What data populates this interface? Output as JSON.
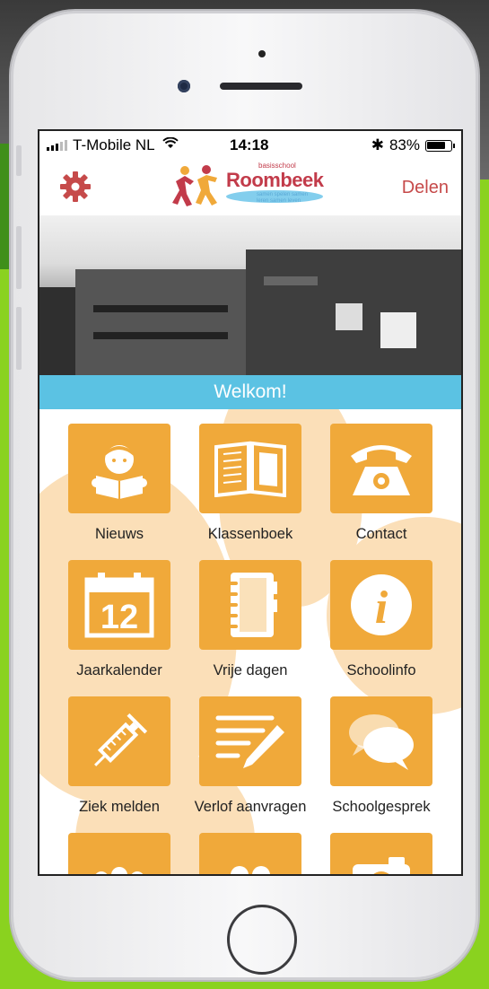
{
  "status_bar": {
    "carrier": "T-Mobile NL",
    "time": "14:18",
    "bluetooth": "✱",
    "battery": "83%",
    "battery_level": 0.83
  },
  "nav": {
    "logo_small": "basisschool",
    "logo_name": "Roombeek",
    "logo_tagline": "samen spelen samen leren samen leven",
    "share_label": "Delen"
  },
  "banner": {
    "welcome": "Welkom!"
  },
  "tiles": [
    {
      "label": "Nieuws",
      "icon": "reader-icon"
    },
    {
      "label": "Klassenboek",
      "icon": "book-icon"
    },
    {
      "label": "Contact",
      "icon": "phone-icon"
    },
    {
      "label": "Jaarkalender",
      "icon": "calendar-icon",
      "icon_text": "12"
    },
    {
      "label": "Vrije dagen",
      "icon": "notebook-icon"
    },
    {
      "label": "Schoolinfo",
      "icon": "info-icon",
      "icon_text": "i"
    },
    {
      "label": "Ziek melden",
      "icon": "syringe-icon"
    },
    {
      "label": "Verlof aanvragen",
      "icon": "form-pencil-icon"
    },
    {
      "label": "Schoolgesprek",
      "icon": "speech-bubbles-icon"
    },
    {
      "label": "",
      "icon": "group-icon"
    },
    {
      "label": "",
      "icon": "people-icon"
    },
    {
      "label": "",
      "icon": "camera-icon"
    }
  ],
  "colors": {
    "tile": "#f0a93a",
    "accent_red": "#c64a4a",
    "banner_blue": "#5bc2e3",
    "bg_blob": "#fbdfb8"
  }
}
